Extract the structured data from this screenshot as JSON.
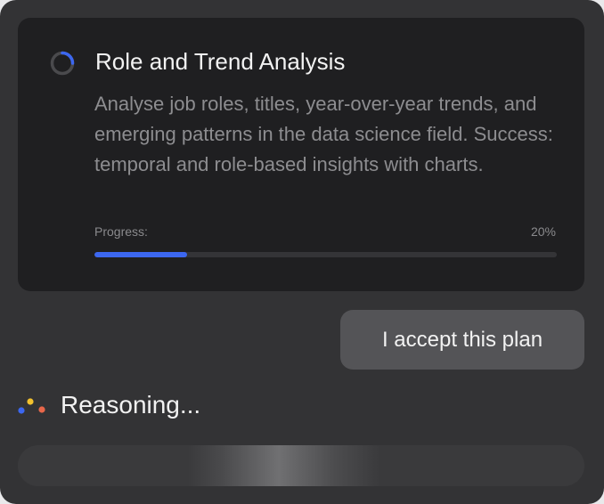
{
  "task": {
    "title": "Role and Trend Analysis",
    "description": "Analyse job roles, titles, year-over-year trends, and emerging patterns in the data science field. Success: temporal and role-based insights with charts.",
    "progress_label": "Progress:",
    "progress_text": "20%",
    "progress_fraction": 0.2,
    "status_icon": "spinner-icon"
  },
  "actions": {
    "accept_label": "I accept this plan"
  },
  "status": {
    "reasoning_label": "Reasoning...",
    "reasoning_icon": "reasoning-dots-icon"
  },
  "colors": {
    "accent": "#3c67f0",
    "dot_blue": "#3c67f0",
    "dot_yellow": "#f2c12e",
    "dot_orange": "#e8674a"
  }
}
